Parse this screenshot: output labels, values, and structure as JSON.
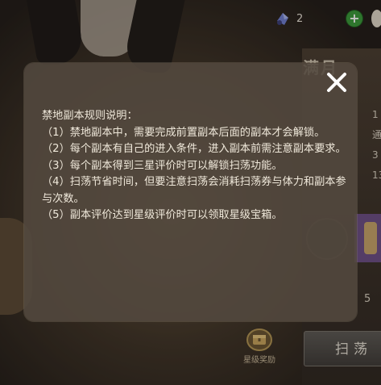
{
  "hud": {
    "currency_value": "2",
    "plus_label": "+",
    "title_partial": "满月",
    "side_numbers": [
      "1",
      "通",
      "3",
      "13"
    ],
    "page_indicator": "5",
    "star_reward_label": "星级奖励",
    "sweep_button_label": "扫荡"
  },
  "dialog": {
    "title": "禁地副本规则说明：",
    "rules": [
      "（1）禁地副本中，需要完成前置副本后面的副本才会解锁。",
      "（2）每个副本有自己的进入条件，进入副本前需注意副本要求。",
      "（3）每个副本得到三星评价时可以解锁扫荡功能。",
      "（4）扫荡节省时间，但要注意扫荡会消耗扫荡券与体力和副本参与次数。",
      "（5）副本评价达到星级评价时可以领取星级宝箱。"
    ],
    "close_icon": "close-icon"
  },
  "colors": {
    "dialog_bg": "#53493f",
    "text": "#efe8da",
    "plus_green": "#3a9a3a",
    "accent_gold": "#c9b99a"
  }
}
